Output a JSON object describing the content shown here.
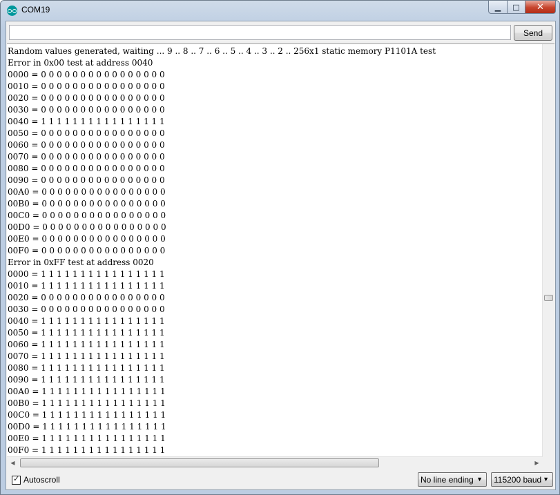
{
  "window": {
    "title": "COM19",
    "minimize": "▁",
    "maximize": "□",
    "close": "✕"
  },
  "toolbar": {
    "input_value": "",
    "send_label": "Send"
  },
  "log": [
    "Random values generated, waiting ... 9 .. 8 .. 7 .. 6 .. 5 .. 4 .. 3 .. 2 .. 256x1 static memory P1101A test",
    "Error in 0x00 test at address 0040",
    "0000 = 0 0 0 0 0 0 0 0 0 0 0 0 0 0 0 0",
    "0010 = 0 0 0 0 0 0 0 0 0 0 0 0 0 0 0 0",
    "0020 = 0 0 0 0 0 0 0 0 0 0 0 0 0 0 0 0",
    "0030 = 0 0 0 0 0 0 0 0 0 0 0 0 0 0 0 0",
    "0040 = 1 1 1 1 1 1 1 1 1 1 1 1 1 1 1 1",
    "0050 = 0 0 0 0 0 0 0 0 0 0 0 0 0 0 0 0",
    "0060 = 0 0 0 0 0 0 0 0 0 0 0 0 0 0 0 0",
    "0070 = 0 0 0 0 0 0 0 0 0 0 0 0 0 0 0 0",
    "0080 = 0 0 0 0 0 0 0 0 0 0 0 0 0 0 0 0",
    "0090 = 0 0 0 0 0 0 0 0 0 0 0 0 0 0 0 0",
    "00A0 = 0 0 0 0 0 0 0 0 0 0 0 0 0 0 0 0",
    "00B0 = 0 0 0 0 0 0 0 0 0 0 0 0 0 0 0 0",
    "00C0 = 0 0 0 0 0 0 0 0 0 0 0 0 0 0 0 0",
    "00D0 = 0 0 0 0 0 0 0 0 0 0 0 0 0 0 0 0",
    "00E0 = 0 0 0 0 0 0 0 0 0 0 0 0 0 0 0 0",
    "00F0 = 0 0 0 0 0 0 0 0 0 0 0 0 0 0 0 0",
    "Error in 0xFF test at address 0020",
    "0000 = 1 1 1 1 1 1 1 1 1 1 1 1 1 1 1 1",
    "0010 = 1 1 1 1 1 1 1 1 1 1 1 1 1 1 1 1",
    "0020 = 0 0 0 0 0 0 0 0 0 0 0 0 0 0 0 0",
    "0030 = 0 0 0 0 0 0 0 0 0 0 0 0 0 0 0 0",
    "0040 = 1 1 1 1 1 1 1 1 1 1 1 1 1 1 1 1",
    "0050 = 1 1 1 1 1 1 1 1 1 1 1 1 1 1 1 1",
    "0060 = 1 1 1 1 1 1 1 1 1 1 1 1 1 1 1 1",
    "0070 = 1 1 1 1 1 1 1 1 1 1 1 1 1 1 1 1",
    "0080 = 1 1 1 1 1 1 1 1 1 1 1 1 1 1 1 1",
    "0090 = 1 1 1 1 1 1 1 1 1 1 1 1 1 1 1 1",
    "00A0 = 1 1 1 1 1 1 1 1 1 1 1 1 1 1 1 1",
    "00B0 = 1 1 1 1 1 1 1 1 1 1 1 1 1 1 1 1",
    "00C0 = 1 1 1 1 1 1 1 1 1 1 1 1 1 1 1 1",
    "00D0 = 1 1 1 1 1 1 1 1 1 1 1 1 1 1 1 1",
    "00E0 = 1 1 1 1 1 1 1 1 1 1 1 1 1 1 1 1",
    "00F0 = 1 1 1 1 1 1 1 1 1 1 1 1 1 1 1 1"
  ],
  "scrollbars": {
    "left_arrow": "◀",
    "right_arrow": "▶"
  },
  "footer": {
    "autoscroll_label": "Autoscroll",
    "autoscroll_checked": true,
    "checkmark": "✓",
    "caret": "▼",
    "line_ending": "No line ending",
    "baud_rate": "115200 baud"
  },
  "icons": {
    "app": "arduino-icon",
    "checkbox": "checkmark-icon",
    "dropdown": "chevron-down-icon"
  },
  "colors": {
    "app_icon": "#00979c",
    "title_bar": "#bccde2",
    "close_button": "#c7452d"
  }
}
